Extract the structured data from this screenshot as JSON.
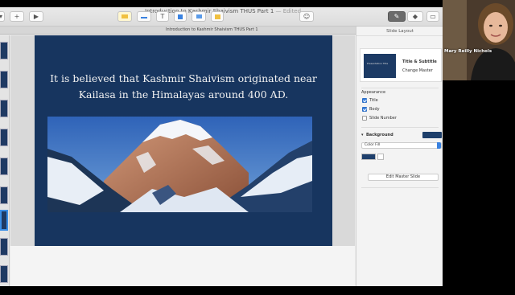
{
  "window": {
    "title": "Introduction to Kashmir Shaivism THUS Part 1",
    "edited": "— Edited",
    "tab_label": "Introduction to Kashmir Shaivism THUS Part 1"
  },
  "slide": {
    "body_text": "It is believed that Kashmir Shaivism originated near Kailasa in the Himalayas around 400 AD.",
    "background_color": "#17355f",
    "photo_subject": "snow-covered mountain peak"
  },
  "inspector": {
    "title": "Slide Layout",
    "master_name": "Title & Subtitle",
    "change_master_label": "Change Master",
    "master_thumb_text": "Presentation Title",
    "appearance_label": "Appearance",
    "options": [
      {
        "label": "Title",
        "checked": true
      },
      {
        "label": "Body",
        "checked": true
      },
      {
        "label": "Slide Number",
        "checked": false
      }
    ],
    "background_label": "Background",
    "fill_type": "Color Fill",
    "fill_color": "#1e3f6b",
    "edit_master_label": "Edit Master Slide"
  },
  "webcam": {
    "participant_name": "Mary Reilly Nichols"
  },
  "colors": {
    "accent": "#3a82e0",
    "slide_bg": "#17355f"
  }
}
